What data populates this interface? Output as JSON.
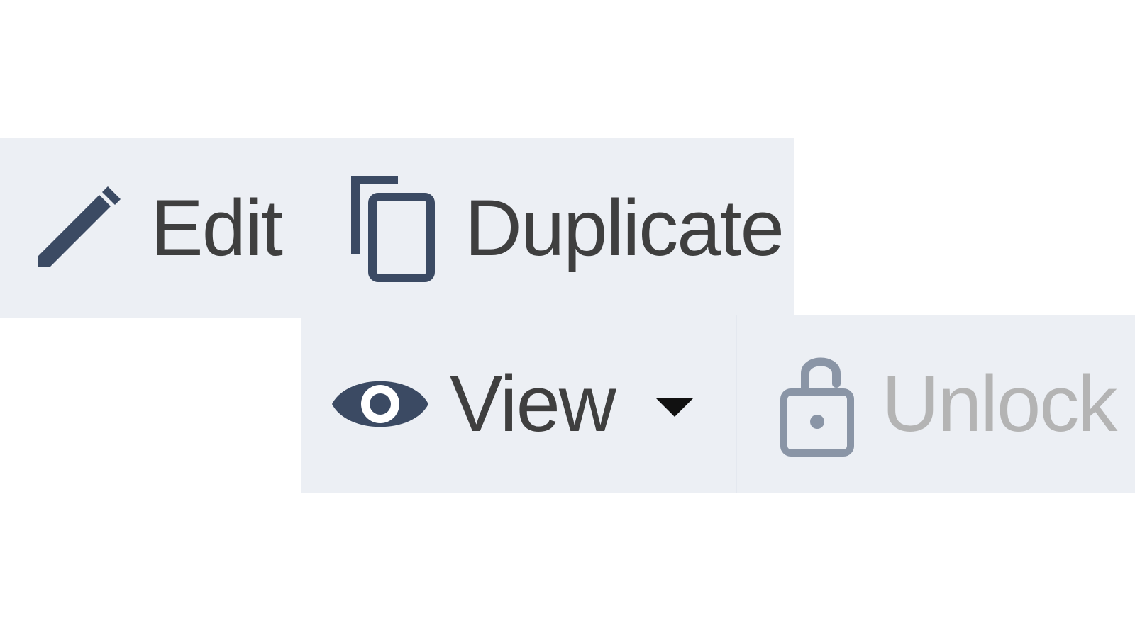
{
  "toolbar": {
    "edit": {
      "label": "Edit",
      "icon": "pencil-icon"
    },
    "duplicate": {
      "label": "Duplicate",
      "icon": "copy-icon"
    },
    "view": {
      "label": "View",
      "icon": "eye-icon",
      "has_dropdown": true
    },
    "unlock": {
      "label": "Unlock",
      "icon": "unlock-icon",
      "disabled": true
    }
  },
  "colors": {
    "button_bg": "#eceff4",
    "icon_primary": "#3b4a63",
    "icon_disabled": "#8a95a6",
    "label_text": "#3f3f3f",
    "label_disabled": "#b4b4b4"
  }
}
